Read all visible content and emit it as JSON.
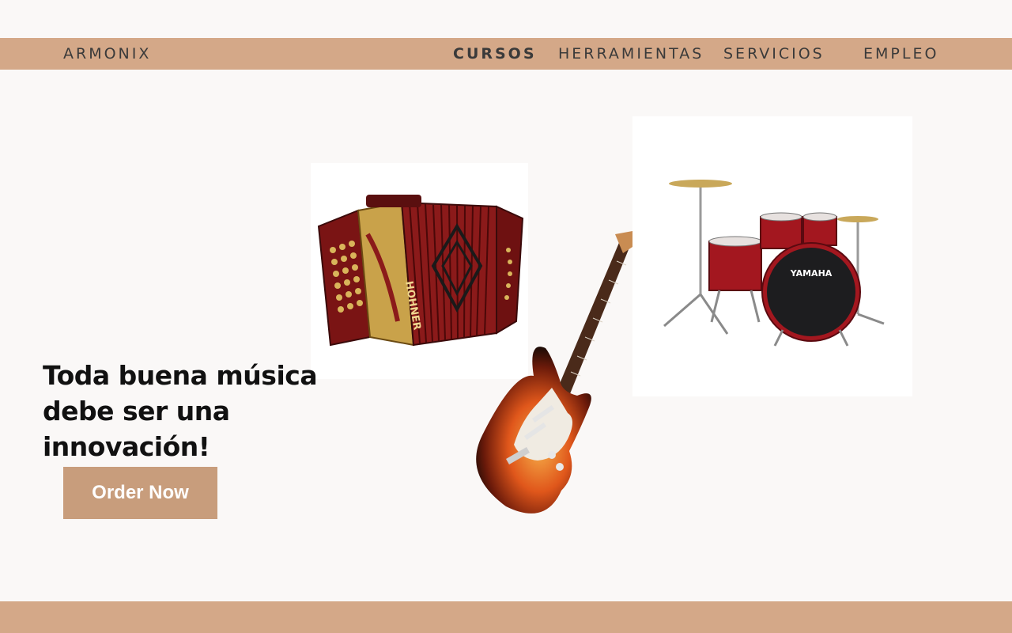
{
  "nav": {
    "brand": "ARMONIX",
    "items": [
      {
        "label": "CURSOS",
        "active": true
      },
      {
        "label": "HERRAMIENTAS",
        "active": false
      },
      {
        "label": "SERVICIOS",
        "active": false
      },
      {
        "label": "EMPLEO",
        "active": false
      }
    ]
  },
  "hero": {
    "headline": "Toda buena música debe ser una innovación!",
    "cta_label": "Order Now",
    "drum_brand": "YAMAHA",
    "accordion_brand": "HOHNER"
  },
  "colors": {
    "band": "#d4a888",
    "button": "#c89d7c",
    "background": "#faf8f7",
    "drum_red": "#a3171f",
    "accordion_red": "#8b1a1a",
    "guitar_sunburst": "#e0571b"
  }
}
